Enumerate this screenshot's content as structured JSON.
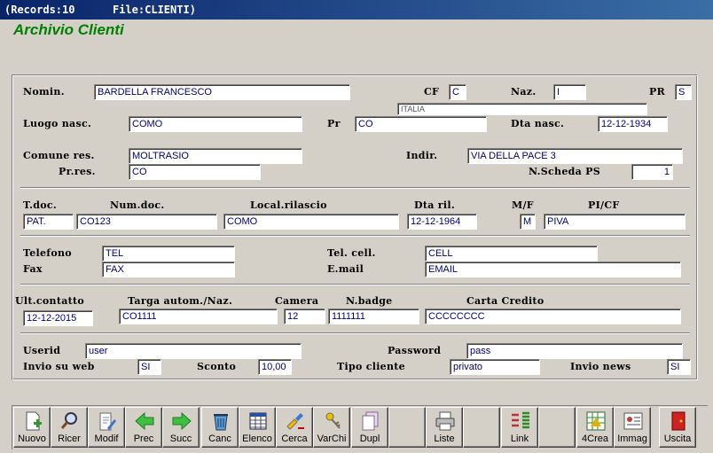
{
  "titlebar": {
    "records": "(Records:10",
    "file": "File:CLIENTI)"
  },
  "app_title": "Archivio Clienti",
  "fields": {
    "nomin": {
      "label": "Nomin.",
      "value": "BARDELLA FRANCESCO"
    },
    "cf": {
      "label": "CF",
      "value": "C"
    },
    "naz": {
      "label": "Naz.",
      "value": "I"
    },
    "pr": {
      "label": "PR",
      "value": "S"
    },
    "naz_desc": "ITALIA",
    "luogo_nasc": {
      "label": "Luogo nasc.",
      "value": "COMO"
    },
    "pr_nasc": {
      "label": "Pr",
      "value": "CO"
    },
    "dta_nasc": {
      "label": "Dta nasc.",
      "value": "12-12-1934"
    },
    "comune_res": {
      "label": "Comune res.",
      "value": "MOLTRASIO"
    },
    "indir": {
      "label": "Indir.",
      "value": "VIA DELLA PACE 3"
    },
    "pr_res": {
      "label": "Pr.res.",
      "value": "CO"
    },
    "n_scheda": {
      "label": "N.Scheda PS",
      "value": "1"
    },
    "t_doc": {
      "label": "T.doc.",
      "value": "PAT."
    },
    "num_doc": {
      "label": "Num.doc.",
      "value": "CO123"
    },
    "local_rilascio": {
      "label": "Local.rilascio",
      "value": "COMO"
    },
    "dta_ril": {
      "label": "Dta ril.",
      "value": "12-12-1964"
    },
    "mf": {
      "label": "M/F",
      "value": "M"
    },
    "pi_cf": {
      "label": "PI/CF",
      "value": "PIVA"
    },
    "telefono": {
      "label": "Telefono",
      "value": "TEL"
    },
    "tel_cell": {
      "label": "Tel. cell.",
      "value": "CELL"
    },
    "fax": {
      "label": "Fax",
      "value": "FAX"
    },
    "email": {
      "label": "E.mail",
      "value": "EMAIL"
    },
    "ult_contatto": {
      "label": "Ult.contatto",
      "value": "12-12-2015"
    },
    "targa": {
      "label": "Targa autom./Naz.",
      "value": "CO1111"
    },
    "camera": {
      "label": "Camera",
      "value": "12"
    },
    "n_badge": {
      "label": "N.badge",
      "value": "1111111"
    },
    "carta_credito": {
      "label": "Carta Credito",
      "value": "CCCCCCCC"
    },
    "userid": {
      "label": "Userid",
      "value": "user"
    },
    "password": {
      "label": "Password",
      "value": "pass"
    },
    "invio_web": {
      "label": "Invio su web",
      "value": "SI"
    },
    "sconto": {
      "label": "Sconto",
      "value": "10,00"
    },
    "tipo_cliente": {
      "label": "Tipo cliente",
      "value": "privato"
    },
    "invio_news": {
      "label": "Invio news",
      "value": "SI"
    }
  },
  "toolbar": [
    {
      "label": "Nuovo",
      "icon": "new-document-icon"
    },
    {
      "label": "Ricer",
      "icon": "search-icon"
    },
    {
      "label": "Modif",
      "icon": "edit-icon"
    },
    {
      "label": "Prec",
      "icon": "arrow-left-icon"
    },
    {
      "label": "Succ",
      "icon": "arrow-right-icon"
    },
    {
      "label": "Canc",
      "icon": "trash-icon"
    },
    {
      "label": "Elenco",
      "icon": "table-icon"
    },
    {
      "label": "Cerca",
      "icon": "find-icon"
    },
    {
      "label": "VarChi",
      "icon": "keys-icon"
    },
    {
      "label": "Dupl",
      "icon": "duplicate-icon"
    },
    {
      "label": "",
      "icon": ""
    },
    {
      "label": "Liste",
      "icon": "printer-icon"
    },
    {
      "label": "",
      "icon": ""
    },
    {
      "label": "Link",
      "icon": "link-icon"
    },
    {
      "label": "",
      "icon": ""
    },
    {
      "label": "4Crea",
      "icon": "create-icon"
    },
    {
      "label": "Immag",
      "icon": "image-icon"
    },
    {
      "label": "",
      "icon": ""
    },
    {
      "label": "Uscita",
      "icon": "exit-icon"
    }
  ],
  "colors": {
    "titlebar": "#0a246a",
    "app_title": "#008000",
    "field_text": "#00007a"
  }
}
